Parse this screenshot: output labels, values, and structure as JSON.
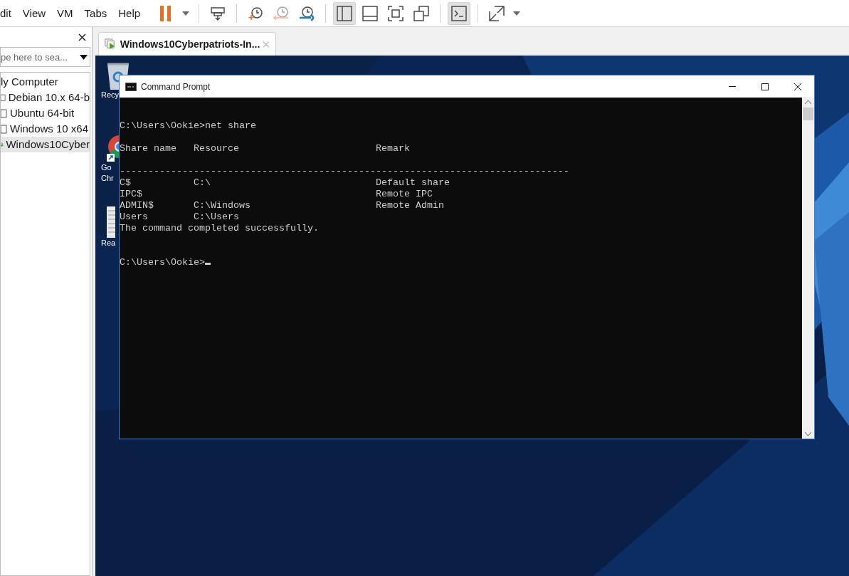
{
  "menu": [
    {
      "label": "dit"
    },
    {
      "label": "View"
    },
    {
      "label": "VM"
    },
    {
      "label": "Tabs"
    },
    {
      "label": "Help"
    }
  ],
  "toolbar": [
    {
      "kind": "pause",
      "pressed": false
    },
    {
      "kind": "caret",
      "pressed": false
    },
    {
      "kind": "sep"
    },
    {
      "kind": "send",
      "pressed": false
    },
    {
      "kind": "sep"
    },
    {
      "kind": "snapshot",
      "pressed": false
    },
    {
      "kind": "revert",
      "pressed": false
    },
    {
      "kind": "manage",
      "pressed": false
    },
    {
      "kind": "sep"
    },
    {
      "kind": "library",
      "pressed": true
    },
    {
      "kind": "thumbs",
      "pressed": false
    },
    {
      "kind": "fullscreen",
      "pressed": false
    },
    {
      "kind": "unity",
      "pressed": false
    },
    {
      "kind": "sep"
    },
    {
      "kind": "console",
      "pressed": true
    },
    {
      "kind": "sep"
    },
    {
      "kind": "stretch",
      "pressed": false
    },
    {
      "kind": "caret",
      "pressed": false
    }
  ],
  "sidebar": {
    "search": {
      "placeholder": "pe here to sea..."
    },
    "tree": [
      {
        "label": "ly Computer",
        "children": [
          {
            "label": "Debian 10.x 64-b",
            "running": false,
            "selected": false
          },
          {
            "label": "Ubuntu 64-bit",
            "running": false,
            "selected": false
          },
          {
            "label": "Windows 10 x64",
            "running": false,
            "selected": false
          },
          {
            "label": "Windows10Cyber",
            "running": true,
            "selected": true
          }
        ]
      }
    ]
  },
  "tabs": [
    {
      "label": "Windows10Cyberpatriots-In...",
      "selected": true
    }
  ],
  "desktop_icons": [
    {
      "kind": "recycle-bin",
      "lines": [
        "Recy"
      ]
    },
    {
      "kind": "browser",
      "lines": [
        "Go",
        "Chr"
      ]
    },
    {
      "kind": "document",
      "lines": [
        "Rea"
      ]
    }
  ],
  "console_window": {
    "title": "Command Prompt",
    "text": "C:\\Users\\Ookie>net share\n\nShare name   Resource                        Remark\n\n-------------------------------------------------------------------------------\nC$           C:\\                             Default share\nIPC$                                         Remote IPC\nADMIN$       C:\\Windows                      Remote Admin\nUsers        C:\\Users\nThe command completed successfully.\n\n\nC:\\Users\\Ookie>",
    "cursor": true
  }
}
